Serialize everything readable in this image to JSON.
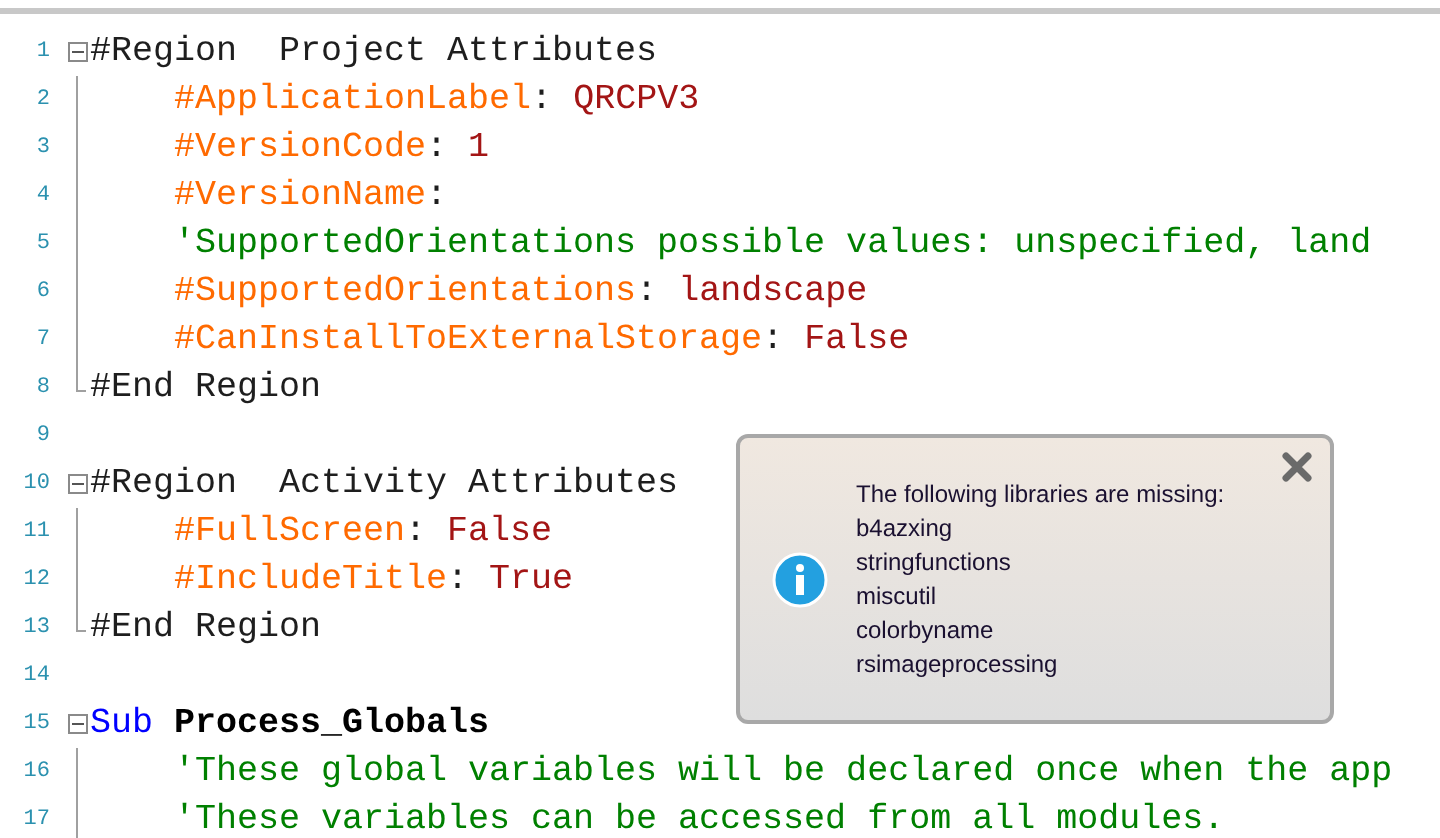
{
  "editor": {
    "lines": [
      {
        "number": "1",
        "kind": "start",
        "expanded": true,
        "tokens": [
          {
            "kind": "plain",
            "text": "#Region  Project Attributes"
          }
        ]
      },
      {
        "number": "2",
        "kind": "body",
        "tokens": [
          {
            "kind": "directive",
            "text": "    #ApplicationLabel"
          },
          {
            "kind": "plain",
            "text": ": "
          },
          {
            "kind": "value",
            "text": "QRCPV3"
          }
        ]
      },
      {
        "number": "3",
        "kind": "body",
        "tokens": [
          {
            "kind": "directive",
            "text": "    #VersionCode"
          },
          {
            "kind": "plain",
            "text": ": "
          },
          {
            "kind": "value",
            "text": "1"
          }
        ]
      },
      {
        "number": "4",
        "kind": "body",
        "tokens": [
          {
            "kind": "directive",
            "text": "    #VersionName"
          },
          {
            "kind": "plain",
            "text": ":"
          }
        ]
      },
      {
        "number": "5",
        "kind": "body",
        "tokens": [
          {
            "kind": "comment",
            "text": "    'SupportedOrientations possible values: unspecified, land"
          }
        ]
      },
      {
        "number": "6",
        "kind": "body",
        "tokens": [
          {
            "kind": "directive",
            "text": "    #SupportedOrientations"
          },
          {
            "kind": "plain",
            "text": ": "
          },
          {
            "kind": "value",
            "text": "landscape"
          }
        ]
      },
      {
        "number": "7",
        "kind": "body",
        "tokens": [
          {
            "kind": "directive",
            "text": "    #CanInstallToExternalStorage"
          },
          {
            "kind": "plain",
            "text": ": "
          },
          {
            "kind": "value",
            "text": "False"
          }
        ]
      },
      {
        "number": "8",
        "kind": "end",
        "tokens": [
          {
            "kind": "plain",
            "text": "#End Region"
          }
        ]
      },
      {
        "number": "9",
        "kind": "blank"
      },
      {
        "number": "10",
        "kind": "start",
        "expanded": true,
        "tokens": [
          {
            "kind": "plain",
            "text": "#Region  Activity Attributes"
          }
        ]
      },
      {
        "number": "11",
        "kind": "body",
        "tokens": [
          {
            "kind": "directive",
            "text": "    #FullScreen"
          },
          {
            "kind": "plain",
            "text": ": "
          },
          {
            "kind": "value",
            "text": "False"
          }
        ]
      },
      {
        "number": "12",
        "kind": "body",
        "tokens": [
          {
            "kind": "directive",
            "text": "    #IncludeTitle"
          },
          {
            "kind": "plain",
            "text": ": "
          },
          {
            "kind": "value",
            "text": "True"
          }
        ]
      },
      {
        "number": "13",
        "kind": "end",
        "tokens": [
          {
            "kind": "plain",
            "text": "#End Region"
          }
        ]
      },
      {
        "number": "14",
        "kind": "blank"
      },
      {
        "number": "15",
        "kind": "start",
        "expanded": true,
        "tokens": [
          {
            "kind": "keyword",
            "text": "Sub"
          },
          {
            "kind": "name",
            "text": " Process_Globals"
          }
        ]
      },
      {
        "number": "16",
        "kind": "body",
        "tokens": [
          {
            "kind": "comment",
            "text": "    'These global variables will be declared once when the app"
          }
        ]
      },
      {
        "number": "17",
        "kind": "body",
        "tokens": [
          {
            "kind": "comment",
            "text": "    'These variables can be accessed from all modules."
          }
        ]
      }
    ]
  },
  "notification": {
    "heading": "The following libraries are missing:",
    "items": [
      "b4azxing",
      "stringfunctions",
      "miscutil",
      "colorbyname",
      "rsimageprocessing"
    ]
  }
}
